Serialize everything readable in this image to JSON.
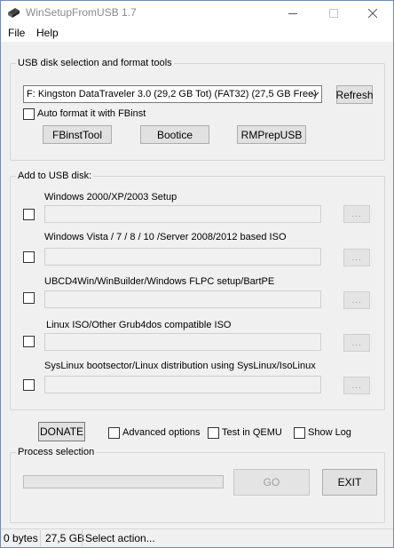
{
  "window": {
    "title": "WinSetupFromUSB 1.7",
    "icons": {
      "app": "usb-drive-icon",
      "minimize": "minimize-icon",
      "maximize": "maximize-icon",
      "close": "close-icon"
    }
  },
  "menu": {
    "file": "File",
    "help": "Help"
  },
  "usb_group": {
    "title": "USB disk selection and format tools",
    "disk_selected": "F: Kingston DataTraveler 3.0 (29,2 GB Tot) (FAT32) (27,5 GB Free)",
    "refresh_label": "Refresh",
    "auto_format_label": "Auto format it with FBinst",
    "auto_format_checked": false,
    "tools": {
      "fbinst": "FBinstTool",
      "bootice": "Bootice",
      "rmprep": "RMPrepUSB"
    }
  },
  "add_group": {
    "title": "Add to USB disk:",
    "items": [
      {
        "label": "Windows 2000/XP/2003 Setup",
        "checked": false,
        "path": "",
        "browse": "..."
      },
      {
        "label": "Windows Vista / 7 / 8 / 10 /Server 2008/2012 based ISO",
        "checked": false,
        "path": "",
        "browse": "..."
      },
      {
        "label": "UBCD4Win/WinBuilder/Windows FLPC setup/BartPE",
        "checked": false,
        "path": "",
        "browse": "..."
      },
      {
        "label": "Linux ISO/Other Grub4dos compatible ISO",
        "checked": false,
        "path": "",
        "browse": "..."
      },
      {
        "label": "SysLinux bootsector/Linux distribution using SysLinux/IsoLinux",
        "checked": false,
        "path": "",
        "browse": "..."
      }
    ]
  },
  "options": {
    "donate": "DONATE",
    "advanced_options": "Advanced options",
    "test_qemu": "Test in QEMU",
    "show_log": "Show Log",
    "advanced_checked": false,
    "qemu_checked": false,
    "log_checked": false
  },
  "process": {
    "title": "Process selection",
    "progress_fraction": 0,
    "go_label": "GO",
    "exit_label": "EXIT"
  },
  "status": {
    "size": "0 bytes",
    "free": "27,5 GB",
    "message": "Select action..."
  },
  "colors": {
    "progress_fill": "#06b025",
    "window_border": "#6e8caf",
    "face": "#f0f0f0"
  }
}
